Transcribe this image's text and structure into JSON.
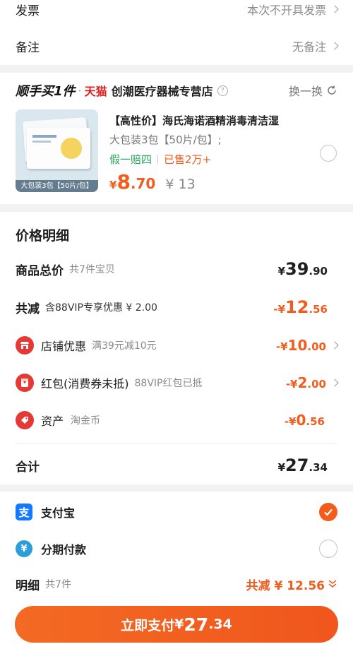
{
  "invoice": {
    "label": "发票",
    "value": "本次不开具发票"
  },
  "remark": {
    "label": "备注",
    "value": "无备注"
  },
  "store": {
    "badge": "顺手买1件",
    "dot": "·",
    "brand": "天猫",
    "name": "创潮医疗器械专营店",
    "swap_label": "换一换"
  },
  "product": {
    "title": "【高性价】海氏海诺酒精消毒清洁湿",
    "spec": "大包装3包【50片/包】;",
    "guarantee": "假一赔四",
    "sold": "已售2万+",
    "price_yen": "¥",
    "price_int": "8",
    "price_dec": ".70",
    "orig_price": "¥ 13",
    "image_caption": "大包装3包【50片/包】"
  },
  "details": {
    "title": "价格明细",
    "goods_total": {
      "label": "商品总价",
      "sub": "共7件宝贝",
      "yen": "¥",
      "int": "39",
      "dec": ".90"
    },
    "total_discount": {
      "label": "共减",
      "sub": "含88VIP专享优惠 ¥ 2.00",
      "sign": "-¥",
      "int": "12",
      "dec": ".56"
    },
    "items": [
      {
        "label": "店铺优惠",
        "sub": "满39元减10元",
        "sign": "-¥",
        "int": "10",
        "dec": ".00",
        "icon": "store-icon"
      },
      {
        "label": "红包(消费券未抵)",
        "sub": "88VIP红包已抵",
        "sign": "-¥",
        "int": "2",
        "dec": ".00",
        "icon": "red-packet-icon"
      },
      {
        "label": "资产",
        "sub": "淘金币",
        "sign": "-¥",
        "int": "0",
        "dec": ".56",
        "icon": "asset-tag-icon"
      }
    ],
    "sum": {
      "label": "合计",
      "yen": "¥",
      "int": "27",
      "dec": ".34"
    }
  },
  "payment": {
    "alipay": {
      "label": "支付宝",
      "selected": true
    },
    "installment": {
      "label": "分期付款",
      "selected": false
    }
  },
  "footer": {
    "detail_label": "明细",
    "count": "共7件",
    "discount_text": "共减 ¥ 12.56",
    "pay_button": {
      "prefix": "立即支付",
      "yen": "¥",
      "int": "27",
      "dec": ".34"
    }
  },
  "colors": {
    "accent": "#f25d1e",
    "tmall_red": "#e01e1e",
    "alipay_blue": "#1677ff",
    "green": "#26a65b"
  }
}
